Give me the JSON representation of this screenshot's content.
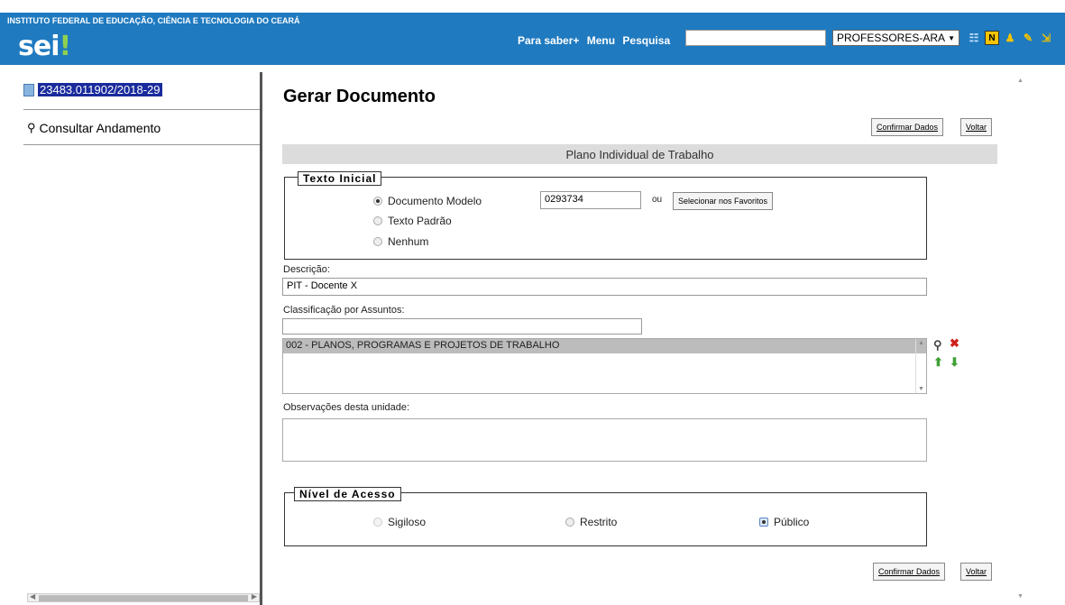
{
  "header": {
    "institution": "INSTITUTO FEDERAL DE EDUCAÇÃO, CIÊNCIA E TECNOLOGIA DO CEARÁ",
    "logo": "sei",
    "logo_dot": "!",
    "nav": [
      "Para saber+",
      "Menu",
      "Pesquisa"
    ],
    "search_value": "",
    "unit_selected": "PROFESSORES-ARA",
    "icons": [
      "grid-icon",
      "notes-icon",
      "user-icon",
      "tools-icon",
      "logout-icon"
    ]
  },
  "sidebar": {
    "process_number": "23483.011902/2018-29",
    "consult_label": "Consultar Andamento"
  },
  "main": {
    "title": "Gerar Documento",
    "confirm_label": "Confirmar Dados",
    "back_label": "Voltar",
    "doc_type": "Plano Individual de Trabalho",
    "initial_text": {
      "legend": "Texto Inicial",
      "options": [
        "Documento Modelo",
        "Texto Padrão",
        "Nenhum"
      ],
      "selected": "Documento Modelo",
      "model_value": "0293734",
      "ou": "ou",
      "favorites_label": "Selecionar nos Favoritos"
    },
    "description_label": "Descrição:",
    "description_value": "PIT - Docente X",
    "classification_label": "Classificação por Assuntos:",
    "classification_search": "",
    "classification_items": [
      "002 - PLANOS, PROGRAMAS E PROJETOS DE TRABALHO"
    ],
    "observations_label": "Observações desta unidade:",
    "observations_value": "",
    "access": {
      "legend": "Nível de Acesso",
      "options": [
        "Sigiloso",
        "Restrito",
        "Público"
      ],
      "selected": "Público"
    }
  },
  "colors": {
    "header_blue": "#1f7ac0",
    "section_gray": "#dcdcdc",
    "selected_process_bg": "#1a2b9c"
  }
}
